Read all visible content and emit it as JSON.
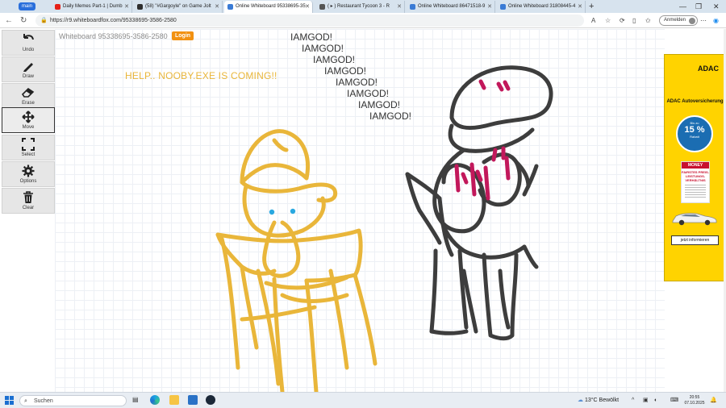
{
  "browser": {
    "profile_label": "main",
    "tabs": [
      {
        "title": "Daily Memes Part-1 | Dumb",
        "color": "#e62117"
      },
      {
        "title": "(58) \"#Gargoyle\" on Game Jolt",
        "color": "#2f2f2f"
      },
      {
        "title": "Online Whiteboard 95338695-35",
        "color": "#3a7bd5"
      },
      {
        "title": "( ▸ ) Restaurant Tycoon 3 - R",
        "color": "#555555"
      },
      {
        "title": "Online Whiteboard 86471518-9",
        "color": "#3a7bd5"
      },
      {
        "title": "Online Whiteboard 31808445-4",
        "color": "#3a7bd5"
      }
    ],
    "active_tab_index": 2,
    "url": "https://r9.whiteboardfox.com/95338695-3586-2580",
    "signin_label": "Anmelden"
  },
  "whiteboard": {
    "board_id": "Whiteboard 95338695-3586-2580",
    "login_label": "Login",
    "tools": [
      {
        "label": "Undo",
        "icon": "undo-icon"
      },
      {
        "label": "Draw",
        "icon": "pencil-icon"
      },
      {
        "label": "Erase",
        "icon": "eraser-icon"
      },
      {
        "label": "Move",
        "icon": "move-icon"
      },
      {
        "label": "Select",
        "icon": "select-icon"
      },
      {
        "label": "Options",
        "icon": "gear-icon"
      },
      {
        "label": "Clear",
        "icon": "trash-icon"
      }
    ],
    "selected_tool": "Move",
    "canvas_texts": {
      "help": "HELP.. NOOBY.EXE IS COMING!!",
      "iamgod": [
        "IAMGOD!",
        "IAMGOD!",
        "IAMGOD!",
        "IAMGOD!",
        "IAMGOD!",
        "IAMGOD!",
        "IAMGOD!",
        "IAMGOD!"
      ]
    },
    "colors": {
      "yellow": "#e9b63a",
      "dark": "#3d3d3d",
      "magenta": "#c2185b",
      "blue": "#29a8e0"
    }
  },
  "ad": {
    "brand": "ADAC",
    "title": "ADAC Autoversicherung",
    "badge_top": "Bis zu",
    "badge_value": "15 %",
    "badge_sub": "Rabatt",
    "card_brand": "MONEY",
    "card_headline": "FAIRSTES PREIS-LEISTUNGS-VERHÄLTNIS",
    "cta": "jetzt informieren"
  },
  "taskbar": {
    "search_placeholder": "Suchen",
    "weather": "13°C Bewölkt",
    "time": "20:55",
    "date": "07.10.2025"
  }
}
